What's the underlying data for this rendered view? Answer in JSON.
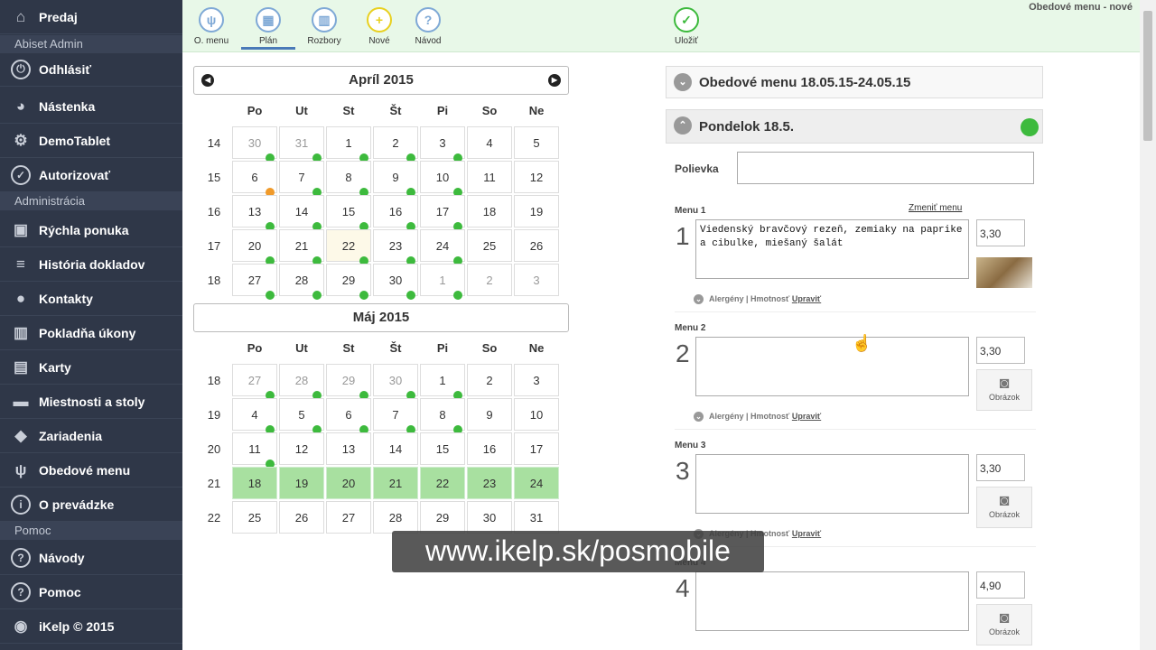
{
  "sidebar": {
    "items": [
      {
        "label": "Predaj",
        "icon": "home-icon"
      },
      {
        "section": "Abiset Admin"
      },
      {
        "label": "Odhlásiť",
        "icon": "power-icon"
      },
      {
        "label": "Nástenka",
        "icon": "dashboard-icon"
      },
      {
        "label": "DemoTablet",
        "icon": "gear-icon"
      },
      {
        "label": "Autorizovať",
        "icon": "check-circle-icon"
      },
      {
        "section": "Administrácia"
      },
      {
        "label": "Rýchla ponuka",
        "icon": "quick-menu-icon"
      },
      {
        "label": "História dokladov",
        "icon": "list-icon"
      },
      {
        "label": "Kontakty",
        "icon": "users-icon"
      },
      {
        "label": "Pokladňa úkony",
        "icon": "bar-chart-icon"
      },
      {
        "label": "Karty",
        "icon": "cards-icon"
      },
      {
        "label": "Miestnosti a stoly",
        "icon": "table-icon"
      },
      {
        "label": "Zariadenia",
        "icon": "diamond-icon"
      },
      {
        "label": "Obedové menu",
        "icon": "fork-knife-icon"
      },
      {
        "label": "O prevádzke",
        "icon": "info-icon"
      },
      {
        "section": "Pomoc"
      },
      {
        "label": "Návody",
        "icon": "question-icon"
      },
      {
        "label": "Pomoc",
        "icon": "question-icon"
      },
      {
        "label": "iKelp © 2015",
        "icon": "ikelp-logo-icon"
      }
    ]
  },
  "toolbar": {
    "buttons": [
      {
        "label": "O. menu",
        "icon": "fork-knife-icon"
      },
      {
        "label": "Plán",
        "icon": "calendar-icon",
        "active": true
      },
      {
        "label": "Rozbory",
        "icon": "bar-chart-icon"
      },
      {
        "label": "Nové",
        "icon": "plus-icon"
      },
      {
        "label": "Návod",
        "icon": "question-icon"
      },
      {
        "label": "Uložiť",
        "icon": "check-icon"
      }
    ],
    "title": "Obedové menu - nové"
  },
  "calendar": {
    "weekdays": [
      "Po",
      "Ut",
      "St",
      "Št",
      "Pi",
      "So",
      "Ne"
    ],
    "months": [
      {
        "title": "Apríl 2015",
        "weeks": [
          {
            "num": "14",
            "days": [
              [
                "30",
                "other",
                "g"
              ],
              [
                "31",
                "other",
                "g"
              ],
              [
                "1",
                "",
                "g"
              ],
              [
                "2",
                "",
                "g"
              ],
              [
                "3",
                "",
                "g"
              ],
              [
                "4",
                "",
                ""
              ],
              [
                "5",
                "",
                ""
              ]
            ]
          },
          {
            "num": "15",
            "days": [
              [
                "6",
                "",
                "o"
              ],
              [
                "7",
                "",
                "g"
              ],
              [
                "8",
                "",
                "g"
              ],
              [
                "9",
                "",
                "g"
              ],
              [
                "10",
                "",
                "g"
              ],
              [
                "11",
                "",
                ""
              ],
              [
                "12",
                "",
                ""
              ]
            ]
          },
          {
            "num": "16",
            "days": [
              [
                "13",
                "",
                "g"
              ],
              [
                "14",
                "",
                "g"
              ],
              [
                "15",
                "",
                "g"
              ],
              [
                "16",
                "",
                "g"
              ],
              [
                "17",
                "",
                "g"
              ],
              [
                "18",
                "",
                ""
              ],
              [
                "19",
                "",
                ""
              ]
            ]
          },
          {
            "num": "17",
            "days": [
              [
                "20",
                "",
                "g"
              ],
              [
                "21",
                "",
                "g"
              ],
              [
                "22",
                "today",
                "g"
              ],
              [
                "23",
                "",
                "g"
              ],
              [
                "24",
                "",
                "g"
              ],
              [
                "25",
                "",
                ""
              ],
              [
                "26",
                "",
                ""
              ]
            ]
          },
          {
            "num": "18",
            "days": [
              [
                "27",
                "",
                "g"
              ],
              [
                "28",
                "",
                "g"
              ],
              [
                "29",
                "",
                "g"
              ],
              [
                "30",
                "",
                "g"
              ],
              [
                "1",
                "other",
                "g"
              ],
              [
                "2",
                "other",
                ""
              ],
              [
                "3",
                "other",
                ""
              ]
            ]
          }
        ]
      },
      {
        "title": "Máj 2015",
        "weeks": [
          {
            "num": "18",
            "days": [
              [
                "27",
                "other",
                "g"
              ],
              [
                "28",
                "other",
                "g"
              ],
              [
                "29",
                "other",
                "g"
              ],
              [
                "30",
                "other",
                "g"
              ],
              [
                "1",
                "",
                "g"
              ],
              [
                "2",
                "",
                ""
              ],
              [
                "3",
                "",
                ""
              ]
            ]
          },
          {
            "num": "19",
            "days": [
              [
                "4",
                "",
                "g"
              ],
              [
                "5",
                "",
                "g"
              ],
              [
                "6",
                "",
                "g"
              ],
              [
                "7",
                "",
                "g"
              ],
              [
                "8",
                "",
                "g"
              ],
              [
                "9",
                "",
                ""
              ],
              [
                "10",
                "",
                ""
              ]
            ]
          },
          {
            "num": "20",
            "days": [
              [
                "11",
                "",
                "g"
              ],
              [
                "12",
                "",
                ""
              ],
              [
                "13",
                "",
                ""
              ],
              [
                "14",
                "",
                ""
              ],
              [
                "15",
                "",
                ""
              ],
              [
                "16",
                "",
                ""
              ],
              [
                "17",
                "",
                ""
              ]
            ]
          },
          {
            "num": "21",
            "days": [
              [
                "18",
                "sel",
                ""
              ],
              [
                "19",
                "sel",
                ""
              ],
              [
                "20",
                "sel",
                ""
              ],
              [
                "21",
                "sel",
                ""
              ],
              [
                "22",
                "sel",
                ""
              ],
              [
                "23",
                "sel",
                ""
              ],
              [
                "24",
                "sel",
                ""
              ]
            ]
          },
          {
            "num": "22",
            "days": [
              [
                "25",
                "",
                ""
              ],
              [
                "26",
                "",
                ""
              ],
              [
                "27",
                "",
                ""
              ],
              [
                "28",
                "",
                ""
              ],
              [
                "29",
                "",
                ""
              ],
              [
                "30",
                "",
                ""
              ],
              [
                "31",
                "",
                ""
              ]
            ]
          }
        ]
      }
    ]
  },
  "menu_panel": {
    "title": "Obedové menu 18.05.15-24.05.15",
    "day_title": "Pondelok 18.5.",
    "soup_label": "Polievka",
    "soup_value": "",
    "change_menu": "Zmeniť menu",
    "allergens_text": "Alergény | Hmotnosť",
    "edit_link": "Upraviť",
    "image_label": "Obrázok",
    "items": [
      {
        "label": "Menu 1",
        "num": "1",
        "text": "Viedenský bravčový rezeň, zemiaky na paprike a cibulke, miešaný šalát",
        "price": "3,30"
      },
      {
        "label": "Menu 2",
        "num": "2",
        "text": "",
        "price": "3,30"
      },
      {
        "label": "Menu 3",
        "num": "3",
        "text": "",
        "price": "3,30"
      },
      {
        "label": "Menu 4",
        "num": "4",
        "text": "",
        "price": "4,90"
      }
    ]
  },
  "watermark": "www.ikelp.sk/posmobile",
  "colors": {
    "sidebar": "#2f3748",
    "toolbar": "#e8f8e8",
    "dot_green": "#3dba3d",
    "dot_orange": "#f09a2a",
    "selected_week": "#a8e0a0"
  }
}
